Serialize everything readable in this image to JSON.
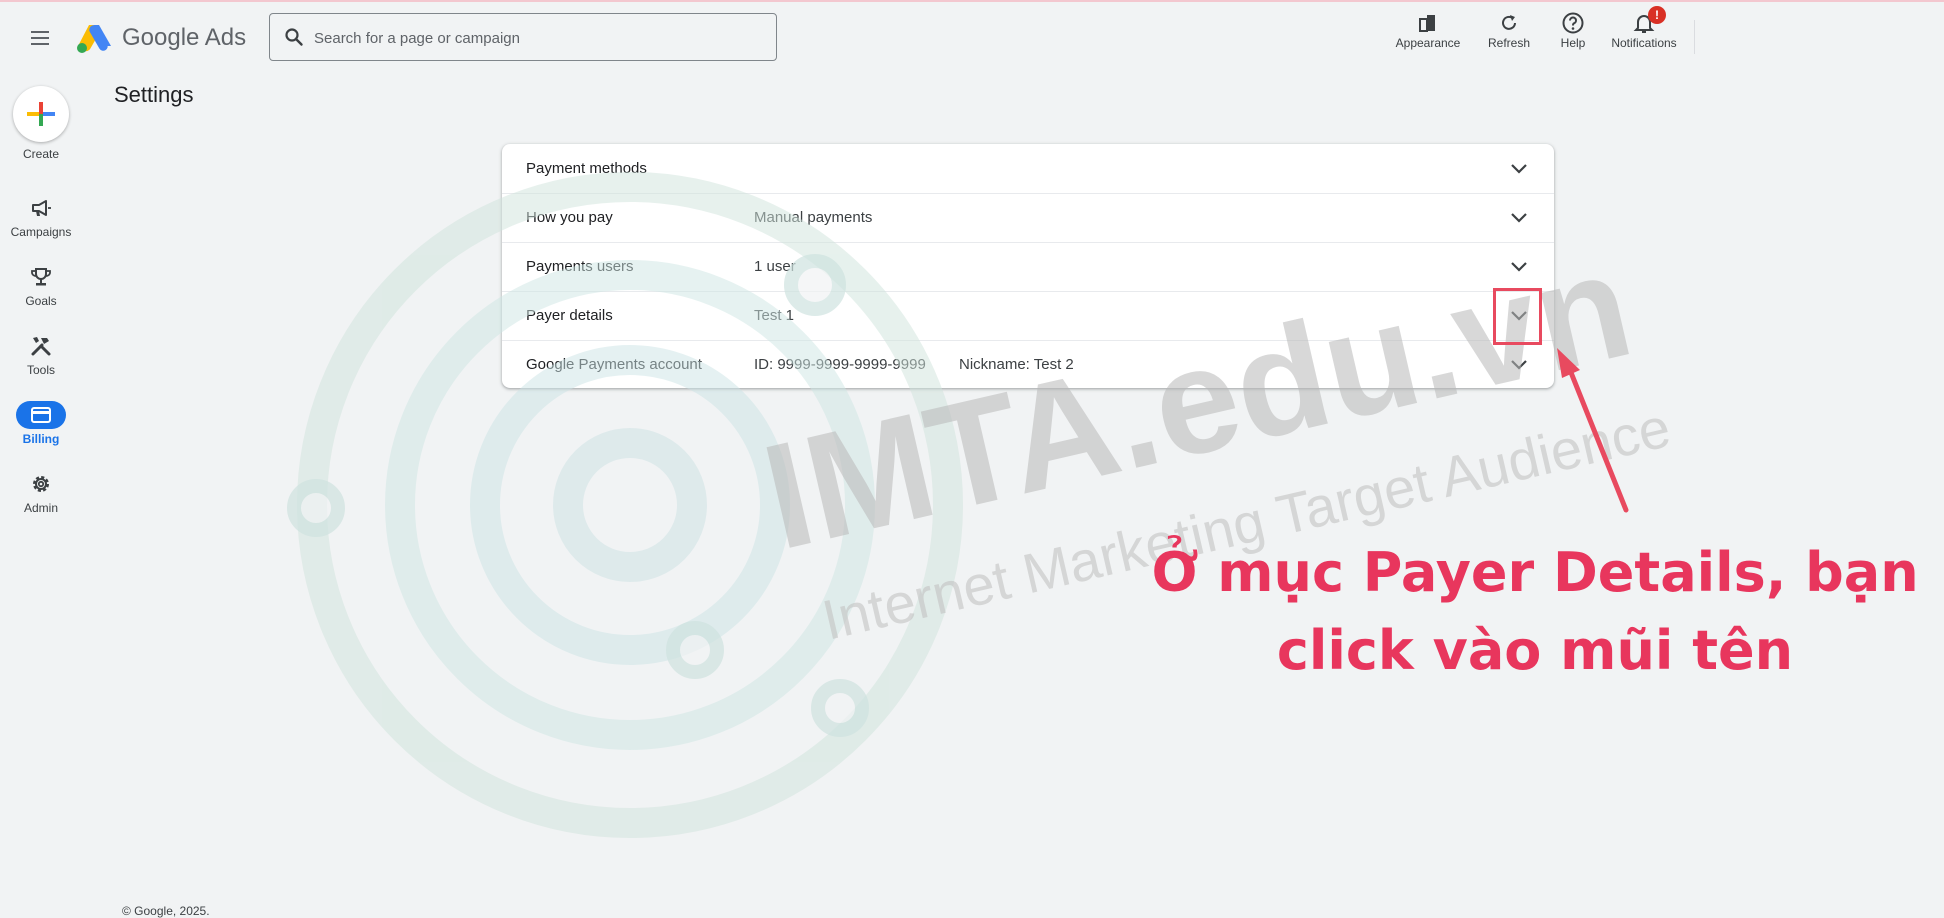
{
  "header": {
    "brand": "Google Ads",
    "search_placeholder": "Search for a page or campaign",
    "tools": [
      {
        "label": "Appearance",
        "icon": "appearance-icon"
      },
      {
        "label": "Refresh",
        "icon": "refresh-icon"
      },
      {
        "label": "Help",
        "icon": "help-icon"
      },
      {
        "label": "Notifications",
        "icon": "bell-icon",
        "badge": "!"
      }
    ]
  },
  "nav": {
    "create_label": "Create",
    "items": [
      {
        "label": "Campaigns",
        "icon": "megaphone-icon"
      },
      {
        "label": "Goals",
        "icon": "trophy-icon"
      },
      {
        "label": "Tools",
        "icon": "tools-icon"
      },
      {
        "label": "Billing",
        "icon": "credit-card-icon",
        "active": true
      },
      {
        "label": "Admin",
        "icon": "gear-icon"
      }
    ]
  },
  "page": {
    "title": "Settings",
    "rows": [
      {
        "label": "Payment methods",
        "value": "",
        "value2": ""
      },
      {
        "label": "How you pay",
        "value": "Manual payments",
        "value2": ""
      },
      {
        "label": "Payments users",
        "value": "1 user",
        "value2": ""
      },
      {
        "label": "Payer details",
        "value": "Test 1",
        "value2": ""
      },
      {
        "label": "Google Payments account",
        "value": "ID: 9999-9999-9999-9999",
        "value2": "Nickname: Test 2"
      }
    ]
  },
  "footer": "© Google, 2025.",
  "annotation": {
    "line1": "Ở mục Payer Details, bạn",
    "line2": "click vào mũi tên",
    "color": "#e8365d"
  },
  "watermark": {
    "brand": "IMTA.edu.vn",
    "tagline": "Internet Marketing Target Audience"
  },
  "colors": {
    "accent": "#1a73e8",
    "background": "#f1f3f4",
    "badge": "#d93025"
  }
}
